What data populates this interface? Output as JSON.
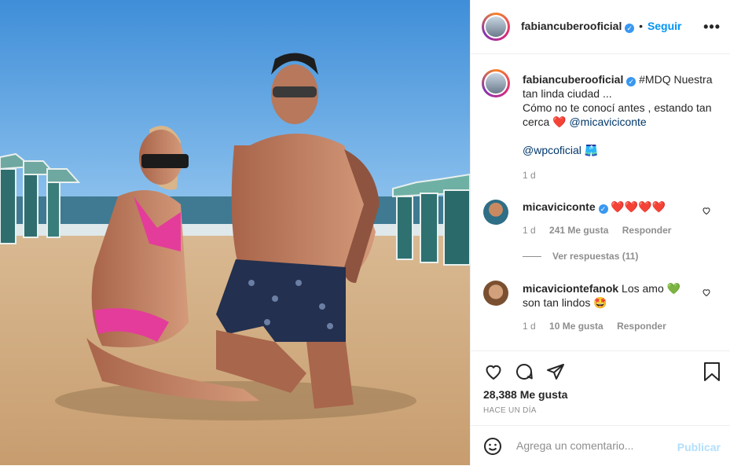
{
  "post": {
    "username": "fabiancuberooficial",
    "follow_label": "Seguir",
    "more_label": "•••",
    "verified_mark": "✓"
  },
  "caption": {
    "username": "fabiancuberooficial",
    "text_line1": "#MDQ Nuestra tan linda ciudad ...",
    "text_line2": "Cómo no te conocí antes , estando tan cerca",
    "heart": "❤️",
    "mention": "@micaviciconte",
    "tag": "@wpcoficial",
    "tag_emoji": "🩳",
    "time": "1 d"
  },
  "comments": [
    {
      "username": "micaviciconte",
      "text": "❤️❤️❤️❤️",
      "time": "1 d",
      "likes": "241 Me gusta",
      "reply": "Responder",
      "view_replies": "Ver respuestas (11)"
    },
    {
      "username": "micaviciontefanok",
      "text_before": "Los amo",
      "emoji1": "💚",
      "text_after": "son tan lindos",
      "emoji2": "🤩",
      "time": "1 d",
      "likes": "10 Me gusta",
      "reply": "Responder"
    }
  ],
  "stats": {
    "likes": "28,388 Me gusta",
    "date": "HACE UN DÍA"
  },
  "add_comment": {
    "placeholder": "Agrega un comentario...",
    "publish": "Publicar"
  },
  "colors": {
    "accent": "#0095f6",
    "verified": "#3897f0",
    "muted": "#8e8e8e"
  }
}
